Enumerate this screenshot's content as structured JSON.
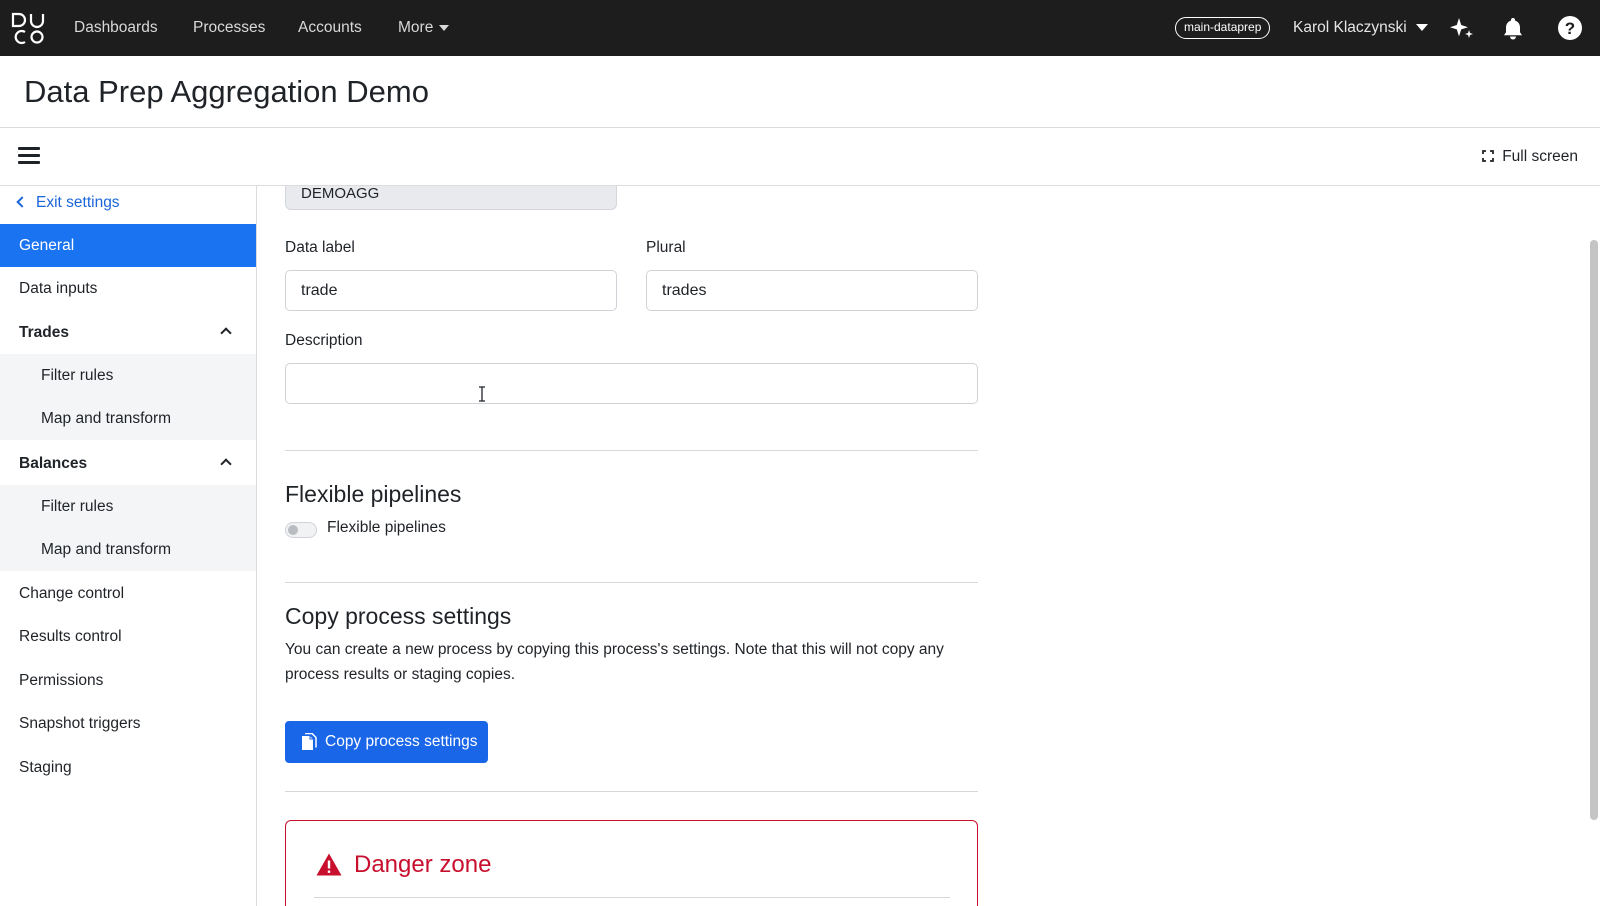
{
  "topnav": {
    "logo_text": "DUCO",
    "items": [
      {
        "label": "Dashboards"
      },
      {
        "label": "Processes"
      },
      {
        "label": "Accounts"
      },
      {
        "label": "More"
      }
    ],
    "env_badge": "main-dataprep",
    "user_name": "Karol Klaczynski",
    "icons": [
      "sparkle-icon",
      "bell-icon",
      "help-icon"
    ]
  },
  "page": {
    "title": "Data Prep Aggregation Demo"
  },
  "toolbar": {
    "fullscreen_label": "Full screen"
  },
  "sidebar": {
    "exit_label": "Exit settings",
    "items": [
      {
        "label": "General",
        "active": true
      },
      {
        "label": "Data inputs"
      },
      {
        "label": "Trades",
        "group": true,
        "expanded": true
      },
      {
        "label": "Filter rules",
        "sub": true
      },
      {
        "label": "Map and transform",
        "sub": true
      },
      {
        "label": "Balances",
        "group": true,
        "expanded": true
      },
      {
        "label": "Filter rules",
        "sub": true
      },
      {
        "label": "Map and transform",
        "sub": true
      },
      {
        "label": "Change control"
      },
      {
        "label": "Results control"
      },
      {
        "label": "Permissions"
      },
      {
        "label": "Snapshot triggers"
      },
      {
        "label": "Staging"
      }
    ]
  },
  "form": {
    "code_value": "DEMOAGG",
    "data_label": {
      "label": "Data label",
      "value": "trade"
    },
    "plural": {
      "label": "Plural",
      "value": "trades"
    },
    "description": {
      "label": "Description",
      "value": ""
    }
  },
  "flexible": {
    "title": "Flexible pipelines",
    "toggle_label": "Flexible pipelines",
    "toggle_on": false
  },
  "copy": {
    "title": "Copy process settings",
    "description": "You can create a new process by copying this process's settings. Note that this will not copy any process results or staging copies.",
    "button_label": "Copy process settings"
  },
  "danger": {
    "title": "Danger zone"
  },
  "colors": {
    "topnav_bg": "#1d1d1d",
    "accent": "#1a73f0",
    "danger": "#c8102e"
  }
}
